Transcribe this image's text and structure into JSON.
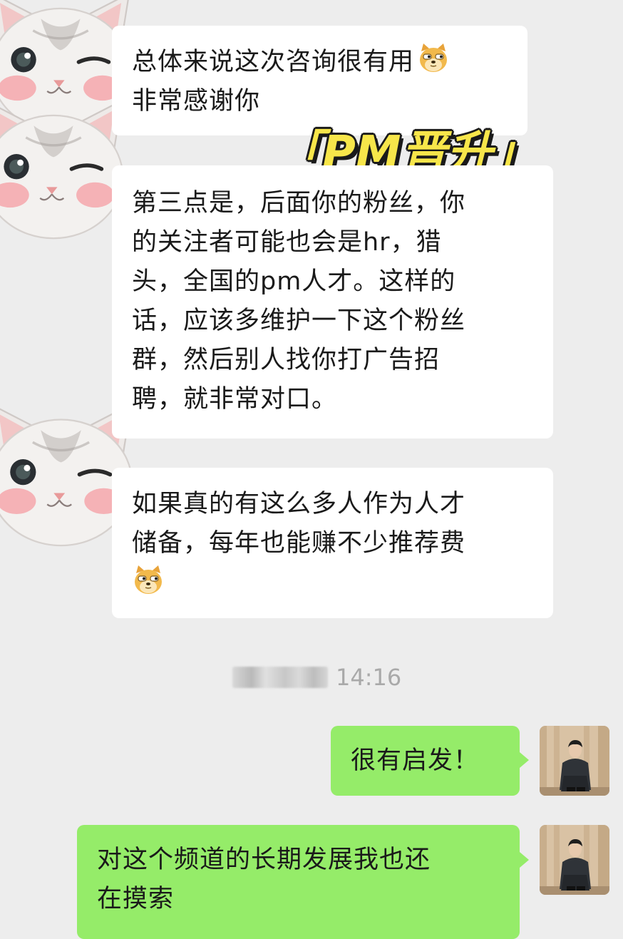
{
  "messages": {
    "m1": [
      "总体来说这次咨询很有用",
      "非常感谢你"
    ],
    "m2": [
      "第三点是，后面你的粉丝，你",
      "的关注者可能也会是hr，猎",
      "头，全国的pm人才。这样的",
      "话，应该多维护一下这个粉丝",
      "群，然后别人找你打广告招",
      "聘，就非常对口。"
    ],
    "m3": [
      "如果真的有这么多人作为人才",
      "储备，每年也能赚不少推荐费"
    ],
    "m4": "很有启发！",
    "m5": [
      "对这个频道的长期发展我也还",
      "在摸索"
    ]
  },
  "timestamp": "14:16",
  "banner": {
    "open": "「",
    "text": "PM晋升",
    "close": "」"
  },
  "icons": {
    "emoji": "doge-emoji-icon",
    "avatar_left": "cat-avatar-icon",
    "avatar_right": "user-avatar"
  },
  "colors": {
    "background": "#ededed",
    "incoming": "#ffffff",
    "outgoing": "#95ec69",
    "banner": "#f7e64a"
  }
}
